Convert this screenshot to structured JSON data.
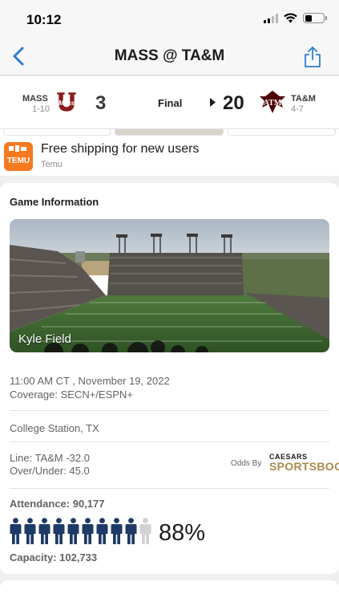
{
  "status": {
    "time": "10:12"
  },
  "nav": {
    "title": "MASS @ TA&M"
  },
  "scoreboard": {
    "away": {
      "abbr": "MASS",
      "record": "1-10",
      "score": "3",
      "logo_color": "#881c1c"
    },
    "status": "Final",
    "home": {
      "abbr": "TA&M",
      "record": "4-7",
      "score": "20",
      "logo_color": "#500000"
    }
  },
  "ad": {
    "logo_text": "TEMU",
    "title": "Free shipping for new users",
    "advertiser": "Temu",
    "brand_color": "#f47a20"
  },
  "game_info": {
    "heading": "Game Information",
    "venue_name": "Kyle Field",
    "datetime": "11:00 AM CT , November 19, 2022",
    "coverage": "Coverage: SECN+/ESPN+",
    "location": "College Station, TX",
    "line": "Line: TA&M -32.0",
    "over_under": "Over/Under: 45.0",
    "odds_by": "Odds By",
    "sportsbook_top": "CAESARS",
    "sportsbook_bottom": "SPORTSBOOK",
    "attendance": "Attendance: 90,177",
    "capacity": "Capacity: 102,733",
    "fill_percent": "88%",
    "fill_fraction": 0.88,
    "people_icons_total": 10,
    "people_icons_filled": 9,
    "filled_color": "#1f3a66",
    "empty_color": "#d1d1d6"
  }
}
